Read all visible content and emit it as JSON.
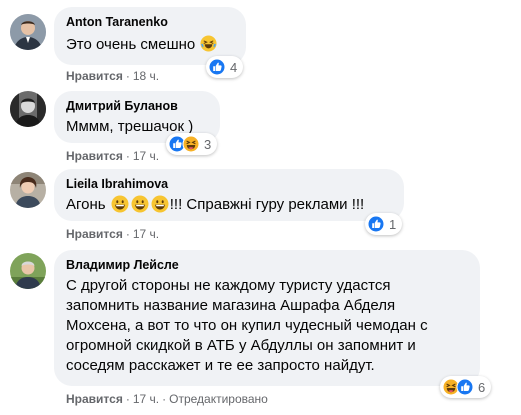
{
  "comments": [
    {
      "author": "Anton Taranenko",
      "text": "Это очень смешно",
      "time": "18 ч.",
      "reaction_count": "4",
      "reactions": [
        "like-icon"
      ],
      "emoji": "laughing-crying-emoji"
    },
    {
      "author": "Дмитрий Буланов",
      "text": "Мммм, трешачок )",
      "time": "17 ч.",
      "reaction_count": "3",
      "reactions": [
        "like-icon",
        "haha-icon"
      ]
    },
    {
      "author": "Lieila Ibrahimova",
      "text_before": "Агонь",
      "text_after": "!!! Справжні гуру реклами !!!",
      "time": "17 ч.",
      "reaction_count": "1",
      "reactions": [
        "like-icon"
      ],
      "emoji": "grinning-emoji"
    },
    {
      "author": "Владимир Лейсле",
      "lines": [
        "С другой стороны не каждому туристу удастся",
        "запомнить название магазина Ашрафа Абделя",
        "Мохсена, а вот то что он купил чудесный чемодан с",
        "огромной скидкой в АТБ у Абдуллы он запомнит и",
        "соседям расскажет и те ее запросто найдут."
      ],
      "time": "17 ч.",
      "edited": "Отредактировано",
      "reaction_count": "6",
      "reactions": [
        "haha-icon",
        "like-icon"
      ]
    }
  ],
  "like_label": "Нравится",
  "separator": "·",
  "colors": {
    "bubble": "#f0f2f5",
    "meta": "#65676b",
    "like_blue": "#1877f2",
    "haha_yellow": "#f7b125"
  }
}
